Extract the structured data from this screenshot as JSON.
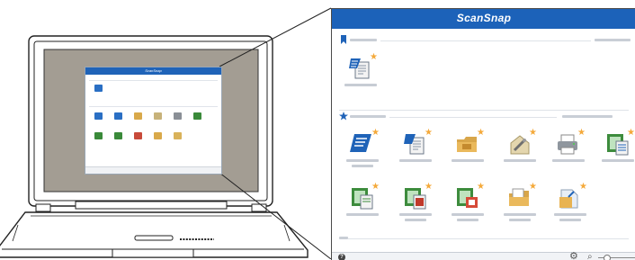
{
  "app_title": "ScanSnap",
  "mini_title": "ScanSnap",
  "colors": {
    "title_bar": "#1c62b9",
    "accent": "#1f63b8",
    "star": "#f4a93a",
    "laptop_screen": "#a39d93"
  },
  "sections": [
    {
      "name": "recent-section",
      "marker_icon": "bookmark-icon"
    },
    {
      "name": "all-apps-section",
      "marker_icon": "star-icon"
    }
  ],
  "recent_apps": [
    {
      "icon": "scan-to-document-icon"
    }
  ],
  "all_apps": [
    {
      "icon": "scansnap-home-icon"
    },
    {
      "icon": "scan-to-document-icon"
    },
    {
      "icon": "scan-to-folder-icon"
    },
    {
      "icon": "scan-to-email-icon"
    },
    {
      "icon": "scan-to-print-icon"
    },
    {
      "icon": "scan-to-excel-icon"
    },
    {
      "icon": "scan-to-excel-icon"
    },
    {
      "icon": "scan-to-word-icon"
    },
    {
      "icon": "scan-to-powerpoint-icon"
    },
    {
      "icon": "scan-to-shared-folder-icon"
    },
    {
      "icon": "scan-to-picture-folder-icon"
    }
  ],
  "footer": {
    "help_symbol": "?",
    "gear_symbol": "⚙",
    "zoom_symbol": "⌕"
  }
}
